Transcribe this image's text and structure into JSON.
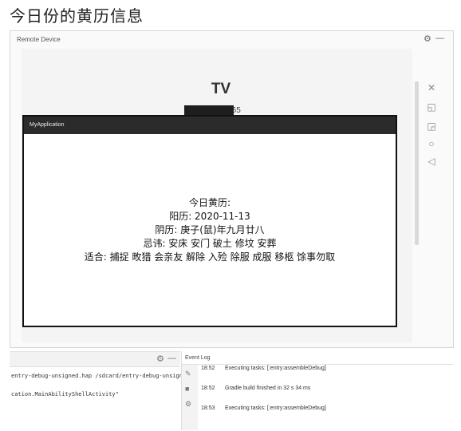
{
  "page": {
    "heading": "今日份的黄历信息"
  },
  "remote_device": {
    "title": "Remote Device",
    "device_label": "TV",
    "timer_icon": "clock-icon",
    "timer": "00:51:55"
  },
  "app": {
    "title": "MyApplication",
    "calendar": {
      "heading": "今日黄历:",
      "solar": "阳历: 2020-11-13",
      "lunar": "阴历: 庚子(鼠)年九月廿八",
      "avoid": "忌讳: 安床 安门 破土 修坟 安葬",
      "suitable": "适合: 捕捉 畋猎 会亲友 解除 入殓 除服 成服 移柩 馀事勿取"
    }
  },
  "terminal": {
    "lines": [
      "entry-debug-unsigned.hap /sdcard/entry-debug-unsign",
      "cation.MainAbilityShellActivity\""
    ]
  },
  "event_log": {
    "title": "Event Log",
    "entries": [
      {
        "time": "18:52",
        "message": "Executing tasks: [:entry:assembleDebug]"
      },
      {
        "time": "18:52",
        "message": "Gradle build finished in 32 s 34 ms"
      },
      {
        "time": "18:53",
        "message": "Executing tasks: [:entry:assembleDebug]"
      }
    ]
  }
}
